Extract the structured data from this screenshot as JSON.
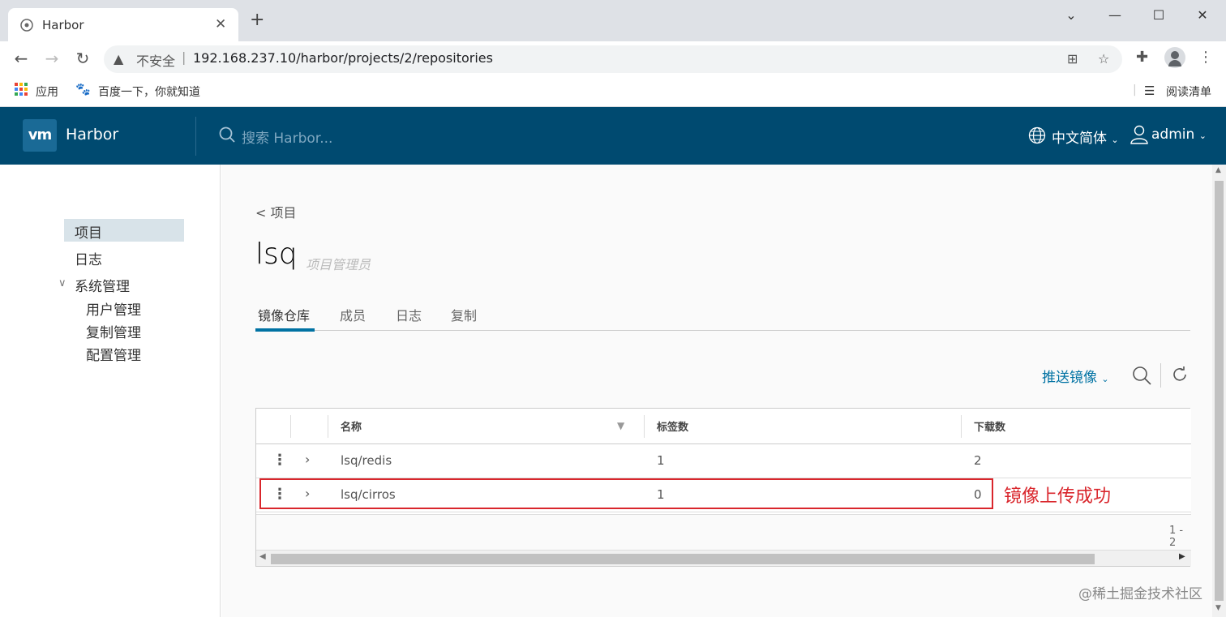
{
  "browser": {
    "tab_title": "Harbor",
    "new_tab": "+",
    "close_tab": "✕",
    "window_controls": {
      "dropdown": "⌄",
      "minimize": "—",
      "maximize": "☐",
      "close": "✕"
    },
    "address": {
      "warning_icon": "warning-triangle-icon",
      "insecure_label": "不安全",
      "separator": "|",
      "url": "192.168.237.10/harbor/projects/2/repositories"
    },
    "bookmarks": {
      "apps": "应用",
      "baidu": "百度一下，你就知道",
      "reading_list": "阅读清单"
    }
  },
  "harbor": {
    "logo_text": "vm",
    "brand": "Harbor",
    "search_placeholder": "搜索 Harbor...",
    "language": "中文简体",
    "user": "admin",
    "header_color": "#004a70"
  },
  "sidebar": {
    "items": [
      {
        "label": "项目"
      },
      {
        "label": "日志"
      },
      {
        "label": "系统管理"
      },
      {
        "label": "用户管理"
      },
      {
        "label": "复制管理"
      },
      {
        "label": "配置管理"
      }
    ]
  },
  "project": {
    "back_link": "< 项目",
    "name": "lsq",
    "role": "项目管理员",
    "tabs": [
      {
        "label": "镜像仓库"
      },
      {
        "label": "成员"
      },
      {
        "label": "日志"
      },
      {
        "label": "复制"
      }
    ],
    "push_image": "推送镜像",
    "grid": {
      "columns": [
        {
          "label": "名称"
        },
        {
          "label": "标签数"
        },
        {
          "label": "下载数"
        }
      ],
      "rows": [
        {
          "name": "lsq/redis",
          "tags": "1",
          "pulls": "2"
        },
        {
          "name": "lsq/cirros",
          "tags": "1",
          "pulls": "0"
        }
      ],
      "pagination": "1 - 2"
    }
  },
  "annotation": {
    "text": "镜像上传成功",
    "color": "#d9262c"
  },
  "watermark": "@稀土掘金技术社区"
}
